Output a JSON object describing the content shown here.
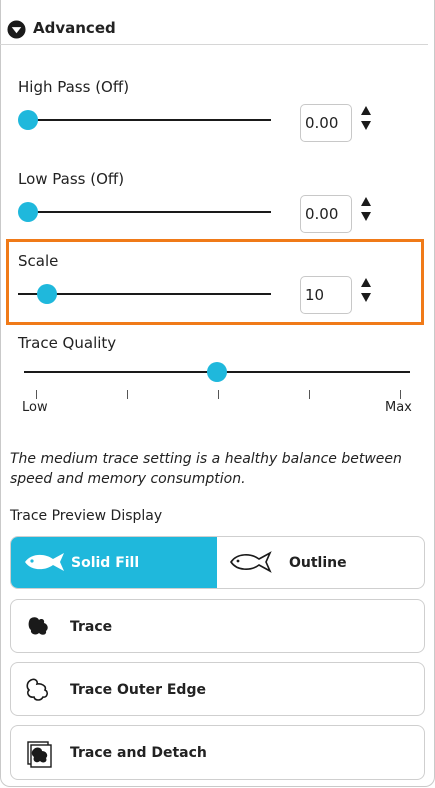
{
  "header": {
    "title": "Advanced",
    "icon": "chevron-down-circle-icon"
  },
  "high_pass": {
    "label": "High Pass (Off)",
    "value": "0.00",
    "slider_fraction": 0.0
  },
  "low_pass": {
    "label": "Low Pass (Off)",
    "value": "0.00",
    "slider_fraction": 0.0
  },
  "scale": {
    "label": "Scale",
    "value": "10",
    "slider_fraction": 0.08
  },
  "trace_quality": {
    "label": "Trace Quality",
    "min_label": "Low",
    "max_label": "Max",
    "slider_fraction": 0.5,
    "tick_count": 5
  },
  "description": "The medium trace setting is a healthy balance between speed and memory consumption.",
  "preview": {
    "label": "Trace Preview Display",
    "solid_fill": "Solid Fill",
    "outline": "Outline",
    "selected": "Solid Fill"
  },
  "buttons": {
    "trace": "Trace",
    "trace_outer_edge": "Trace Outer Edge",
    "trace_and_detach": "Trace and Detach"
  },
  "colors": {
    "accent": "#1fb8dc",
    "highlight": "#f07a18"
  }
}
